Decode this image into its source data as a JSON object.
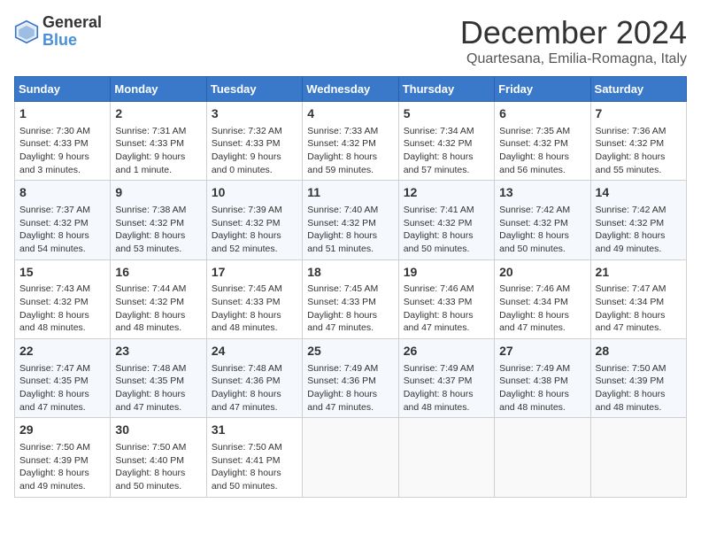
{
  "logo": {
    "line1": "General",
    "line2": "Blue"
  },
  "title": "December 2024",
  "location": "Quartesana, Emilia-Romagna, Italy",
  "days_of_week": [
    "Sunday",
    "Monday",
    "Tuesday",
    "Wednesday",
    "Thursday",
    "Friday",
    "Saturday"
  ],
  "weeks": [
    [
      {
        "day": "1",
        "content": "Sunrise: 7:30 AM\nSunset: 4:33 PM\nDaylight: 9 hours\nand 3 minutes."
      },
      {
        "day": "2",
        "content": "Sunrise: 7:31 AM\nSunset: 4:33 PM\nDaylight: 9 hours\nand 1 minute."
      },
      {
        "day": "3",
        "content": "Sunrise: 7:32 AM\nSunset: 4:33 PM\nDaylight: 9 hours\nand 0 minutes."
      },
      {
        "day": "4",
        "content": "Sunrise: 7:33 AM\nSunset: 4:32 PM\nDaylight: 8 hours\nand 59 minutes."
      },
      {
        "day": "5",
        "content": "Sunrise: 7:34 AM\nSunset: 4:32 PM\nDaylight: 8 hours\nand 57 minutes."
      },
      {
        "day": "6",
        "content": "Sunrise: 7:35 AM\nSunset: 4:32 PM\nDaylight: 8 hours\nand 56 minutes."
      },
      {
        "day": "7",
        "content": "Sunrise: 7:36 AM\nSunset: 4:32 PM\nDaylight: 8 hours\nand 55 minutes."
      }
    ],
    [
      {
        "day": "8",
        "content": "Sunrise: 7:37 AM\nSunset: 4:32 PM\nDaylight: 8 hours\nand 54 minutes."
      },
      {
        "day": "9",
        "content": "Sunrise: 7:38 AM\nSunset: 4:32 PM\nDaylight: 8 hours\nand 53 minutes."
      },
      {
        "day": "10",
        "content": "Sunrise: 7:39 AM\nSunset: 4:32 PM\nDaylight: 8 hours\nand 52 minutes."
      },
      {
        "day": "11",
        "content": "Sunrise: 7:40 AM\nSunset: 4:32 PM\nDaylight: 8 hours\nand 51 minutes."
      },
      {
        "day": "12",
        "content": "Sunrise: 7:41 AM\nSunset: 4:32 PM\nDaylight: 8 hours\nand 50 minutes."
      },
      {
        "day": "13",
        "content": "Sunrise: 7:42 AM\nSunset: 4:32 PM\nDaylight: 8 hours\nand 50 minutes."
      },
      {
        "day": "14",
        "content": "Sunrise: 7:42 AM\nSunset: 4:32 PM\nDaylight: 8 hours\nand 49 minutes."
      }
    ],
    [
      {
        "day": "15",
        "content": "Sunrise: 7:43 AM\nSunset: 4:32 PM\nDaylight: 8 hours\nand 48 minutes."
      },
      {
        "day": "16",
        "content": "Sunrise: 7:44 AM\nSunset: 4:32 PM\nDaylight: 8 hours\nand 48 minutes."
      },
      {
        "day": "17",
        "content": "Sunrise: 7:45 AM\nSunset: 4:33 PM\nDaylight: 8 hours\nand 48 minutes."
      },
      {
        "day": "18",
        "content": "Sunrise: 7:45 AM\nSunset: 4:33 PM\nDaylight: 8 hours\nand 47 minutes."
      },
      {
        "day": "19",
        "content": "Sunrise: 7:46 AM\nSunset: 4:33 PM\nDaylight: 8 hours\nand 47 minutes."
      },
      {
        "day": "20",
        "content": "Sunrise: 7:46 AM\nSunset: 4:34 PM\nDaylight: 8 hours\nand 47 minutes."
      },
      {
        "day": "21",
        "content": "Sunrise: 7:47 AM\nSunset: 4:34 PM\nDaylight: 8 hours\nand 47 minutes."
      }
    ],
    [
      {
        "day": "22",
        "content": "Sunrise: 7:47 AM\nSunset: 4:35 PM\nDaylight: 8 hours\nand 47 minutes."
      },
      {
        "day": "23",
        "content": "Sunrise: 7:48 AM\nSunset: 4:35 PM\nDaylight: 8 hours\nand 47 minutes."
      },
      {
        "day": "24",
        "content": "Sunrise: 7:48 AM\nSunset: 4:36 PM\nDaylight: 8 hours\nand 47 minutes."
      },
      {
        "day": "25",
        "content": "Sunrise: 7:49 AM\nSunset: 4:36 PM\nDaylight: 8 hours\nand 47 minutes."
      },
      {
        "day": "26",
        "content": "Sunrise: 7:49 AM\nSunset: 4:37 PM\nDaylight: 8 hours\nand 48 minutes."
      },
      {
        "day": "27",
        "content": "Sunrise: 7:49 AM\nSunset: 4:38 PM\nDaylight: 8 hours\nand 48 minutes."
      },
      {
        "day": "28",
        "content": "Sunrise: 7:50 AM\nSunset: 4:39 PM\nDaylight: 8 hours\nand 48 minutes."
      }
    ],
    [
      {
        "day": "29",
        "content": "Sunrise: 7:50 AM\nSunset: 4:39 PM\nDaylight: 8 hours\nand 49 minutes."
      },
      {
        "day": "30",
        "content": "Sunrise: 7:50 AM\nSunset: 4:40 PM\nDaylight: 8 hours\nand 50 minutes."
      },
      {
        "day": "31",
        "content": "Sunrise: 7:50 AM\nSunset: 4:41 PM\nDaylight: 8 hours\nand 50 minutes."
      },
      {
        "day": "",
        "content": ""
      },
      {
        "day": "",
        "content": ""
      },
      {
        "day": "",
        "content": ""
      },
      {
        "day": "",
        "content": ""
      }
    ]
  ]
}
